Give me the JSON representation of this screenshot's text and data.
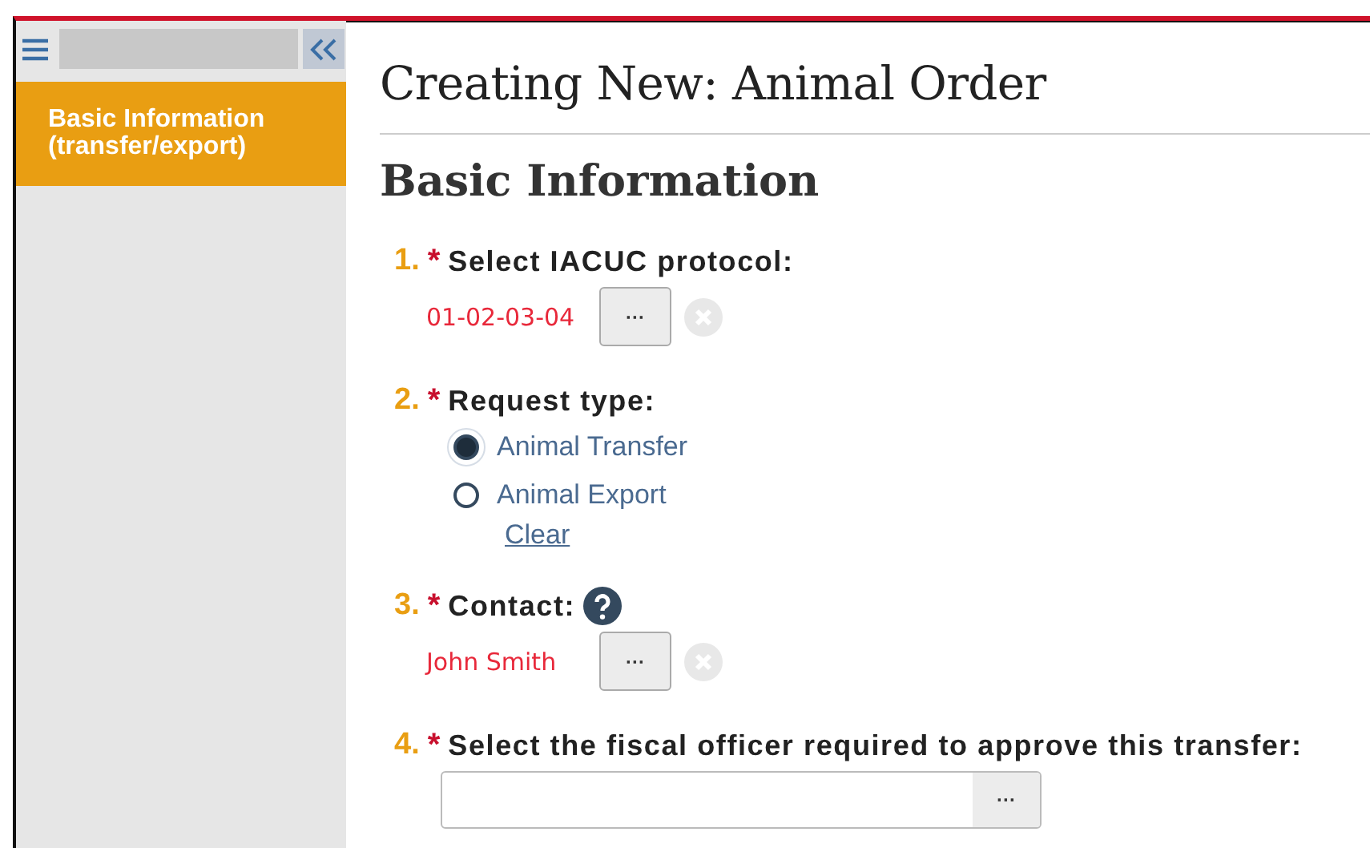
{
  "sidebar": {
    "items": [
      {
        "label": "Basic Information (transfer/export)",
        "selected": true
      }
    ]
  },
  "page_title": "Creating New: Animal Order",
  "section_title": "Basic Information",
  "questions": [
    {
      "kind": "chooser",
      "number": "1.",
      "required_mark": "*",
      "label": "Select IACUC protocol:",
      "value": "01-02-03-04",
      "button": "···"
    },
    {
      "kind": "radio",
      "number": "2.",
      "required_mark": "*",
      "label": "Request type:",
      "options": [
        {
          "label": "Animal Transfer",
          "selected": true
        },
        {
          "label": "Animal Export",
          "selected": false
        }
      ],
      "clear": "Clear"
    },
    {
      "kind": "chooser",
      "number": "3.",
      "required_mark": "*",
      "label": "Contact:",
      "value": "John Smith",
      "button": "···",
      "help": true
    },
    {
      "kind": "picker",
      "number": "4.",
      "required_mark": "*",
      "label": "Select the fiscal officer required to approve this transfer:",
      "button": "···"
    }
  ]
}
